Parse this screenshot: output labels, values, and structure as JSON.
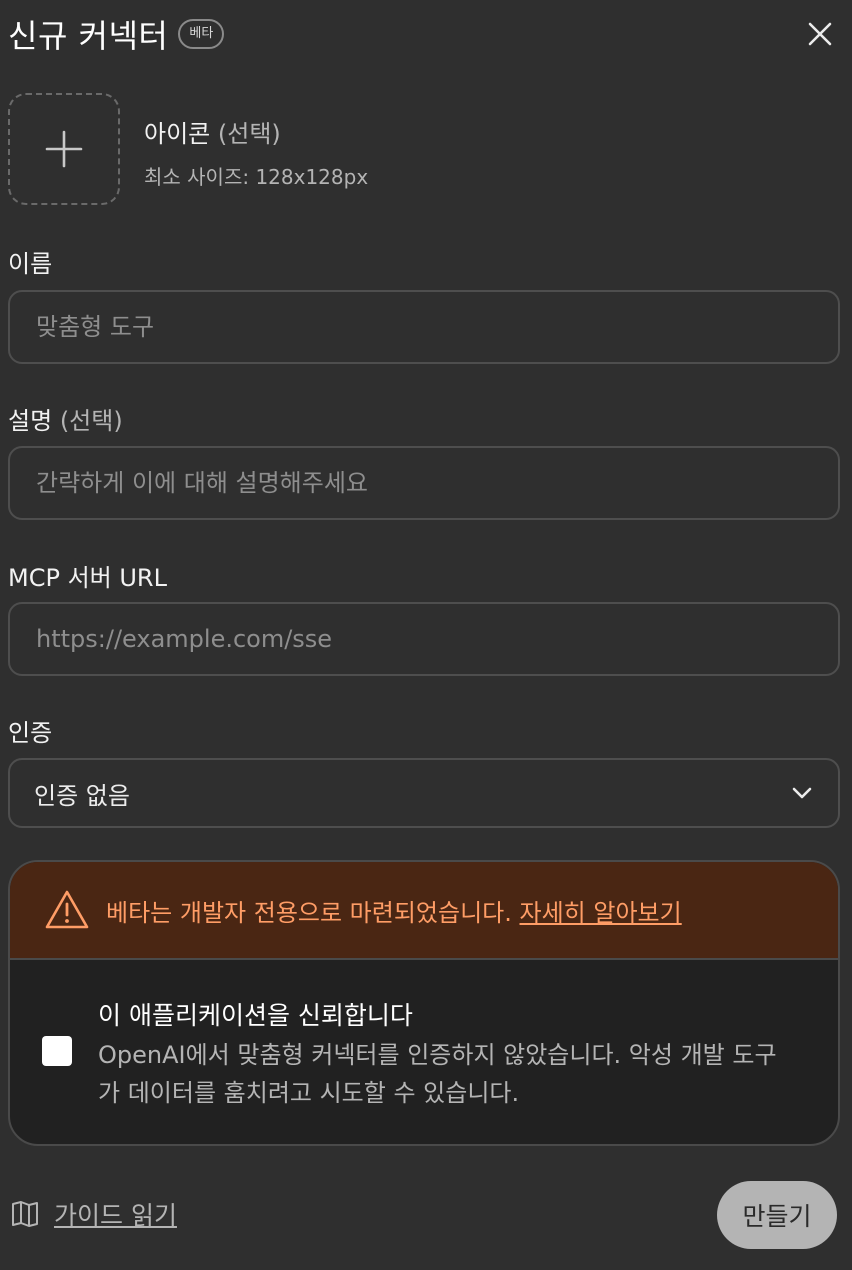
{
  "header": {
    "title": "신규 커넥터",
    "badge": "베타"
  },
  "icon_upload": {
    "title": "아이콘",
    "optional": "(선택)",
    "hint": "최소 사이즈: 128x128px"
  },
  "name_field": {
    "label": "이름",
    "placeholder": "맞춤형 도구"
  },
  "description_field": {
    "label": "설명",
    "optional": "(선택)",
    "placeholder": "간략하게 이에 대해 설명해주세요"
  },
  "url_field": {
    "label": "MCP 서버 URL",
    "placeholder": "https://example.com/sse"
  },
  "auth_field": {
    "label": "인증",
    "value": "인증 없음"
  },
  "warning": {
    "text": "베타는 개발자 전용으로 마련되었습니다.",
    "link": "자세히 알아보기",
    "color": "#ff9d66"
  },
  "trust": {
    "title": "이 애플리케이션을 신뢰합니다",
    "description": "OpenAI에서 맞춤형 커넥터를 인증하지 않았습니다. 악성 개발 도구가 데이터를 훔치려고 시도할 수 있습니다.",
    "checked": false
  },
  "footer": {
    "guide_label": "가이드 읽기",
    "create_label": "만들기"
  }
}
